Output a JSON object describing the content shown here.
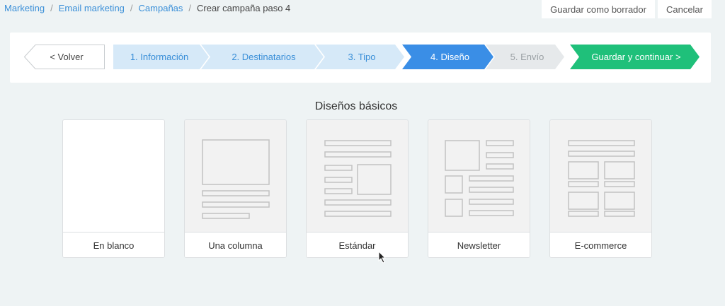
{
  "breadcrumb": {
    "items": [
      "Marketing",
      "Email marketing",
      "Campañas"
    ],
    "current": "Crear campaña paso 4"
  },
  "top_actions": {
    "draft_label": "Guardar como borrador",
    "cancel_label": "Cancelar"
  },
  "stepper": {
    "back_label": "< Volver",
    "steps": [
      {
        "label": "1. Información",
        "state": "done"
      },
      {
        "label": "2. Destinatarios",
        "state": "done"
      },
      {
        "label": "3. Tipo",
        "state": "done"
      },
      {
        "label": "4. Diseño",
        "state": "active"
      },
      {
        "label": "5. Envío",
        "state": "pending"
      }
    ],
    "continue_label": "Guardar y continuar >"
  },
  "section_title": "Diseños básicos",
  "templates": [
    {
      "name": "En blanco",
      "icon": "blank-layout-icon"
    },
    {
      "name": "Una columna",
      "icon": "one-column-layout-icon"
    },
    {
      "name": "Estándar",
      "icon": "standard-layout-icon"
    },
    {
      "name": "Newsletter",
      "icon": "newsletter-layout-icon"
    },
    {
      "name": "E-commerce",
      "icon": "ecommerce-layout-icon"
    }
  ],
  "colors": {
    "link": "#3a8fd8",
    "step_done_bg": "#d6e9f8",
    "step_done_text": "#3a8fd8",
    "step_active_bg": "#3a8ee6",
    "step_pending_bg": "#e6e9eb",
    "continue_bg": "#1fc07a"
  }
}
